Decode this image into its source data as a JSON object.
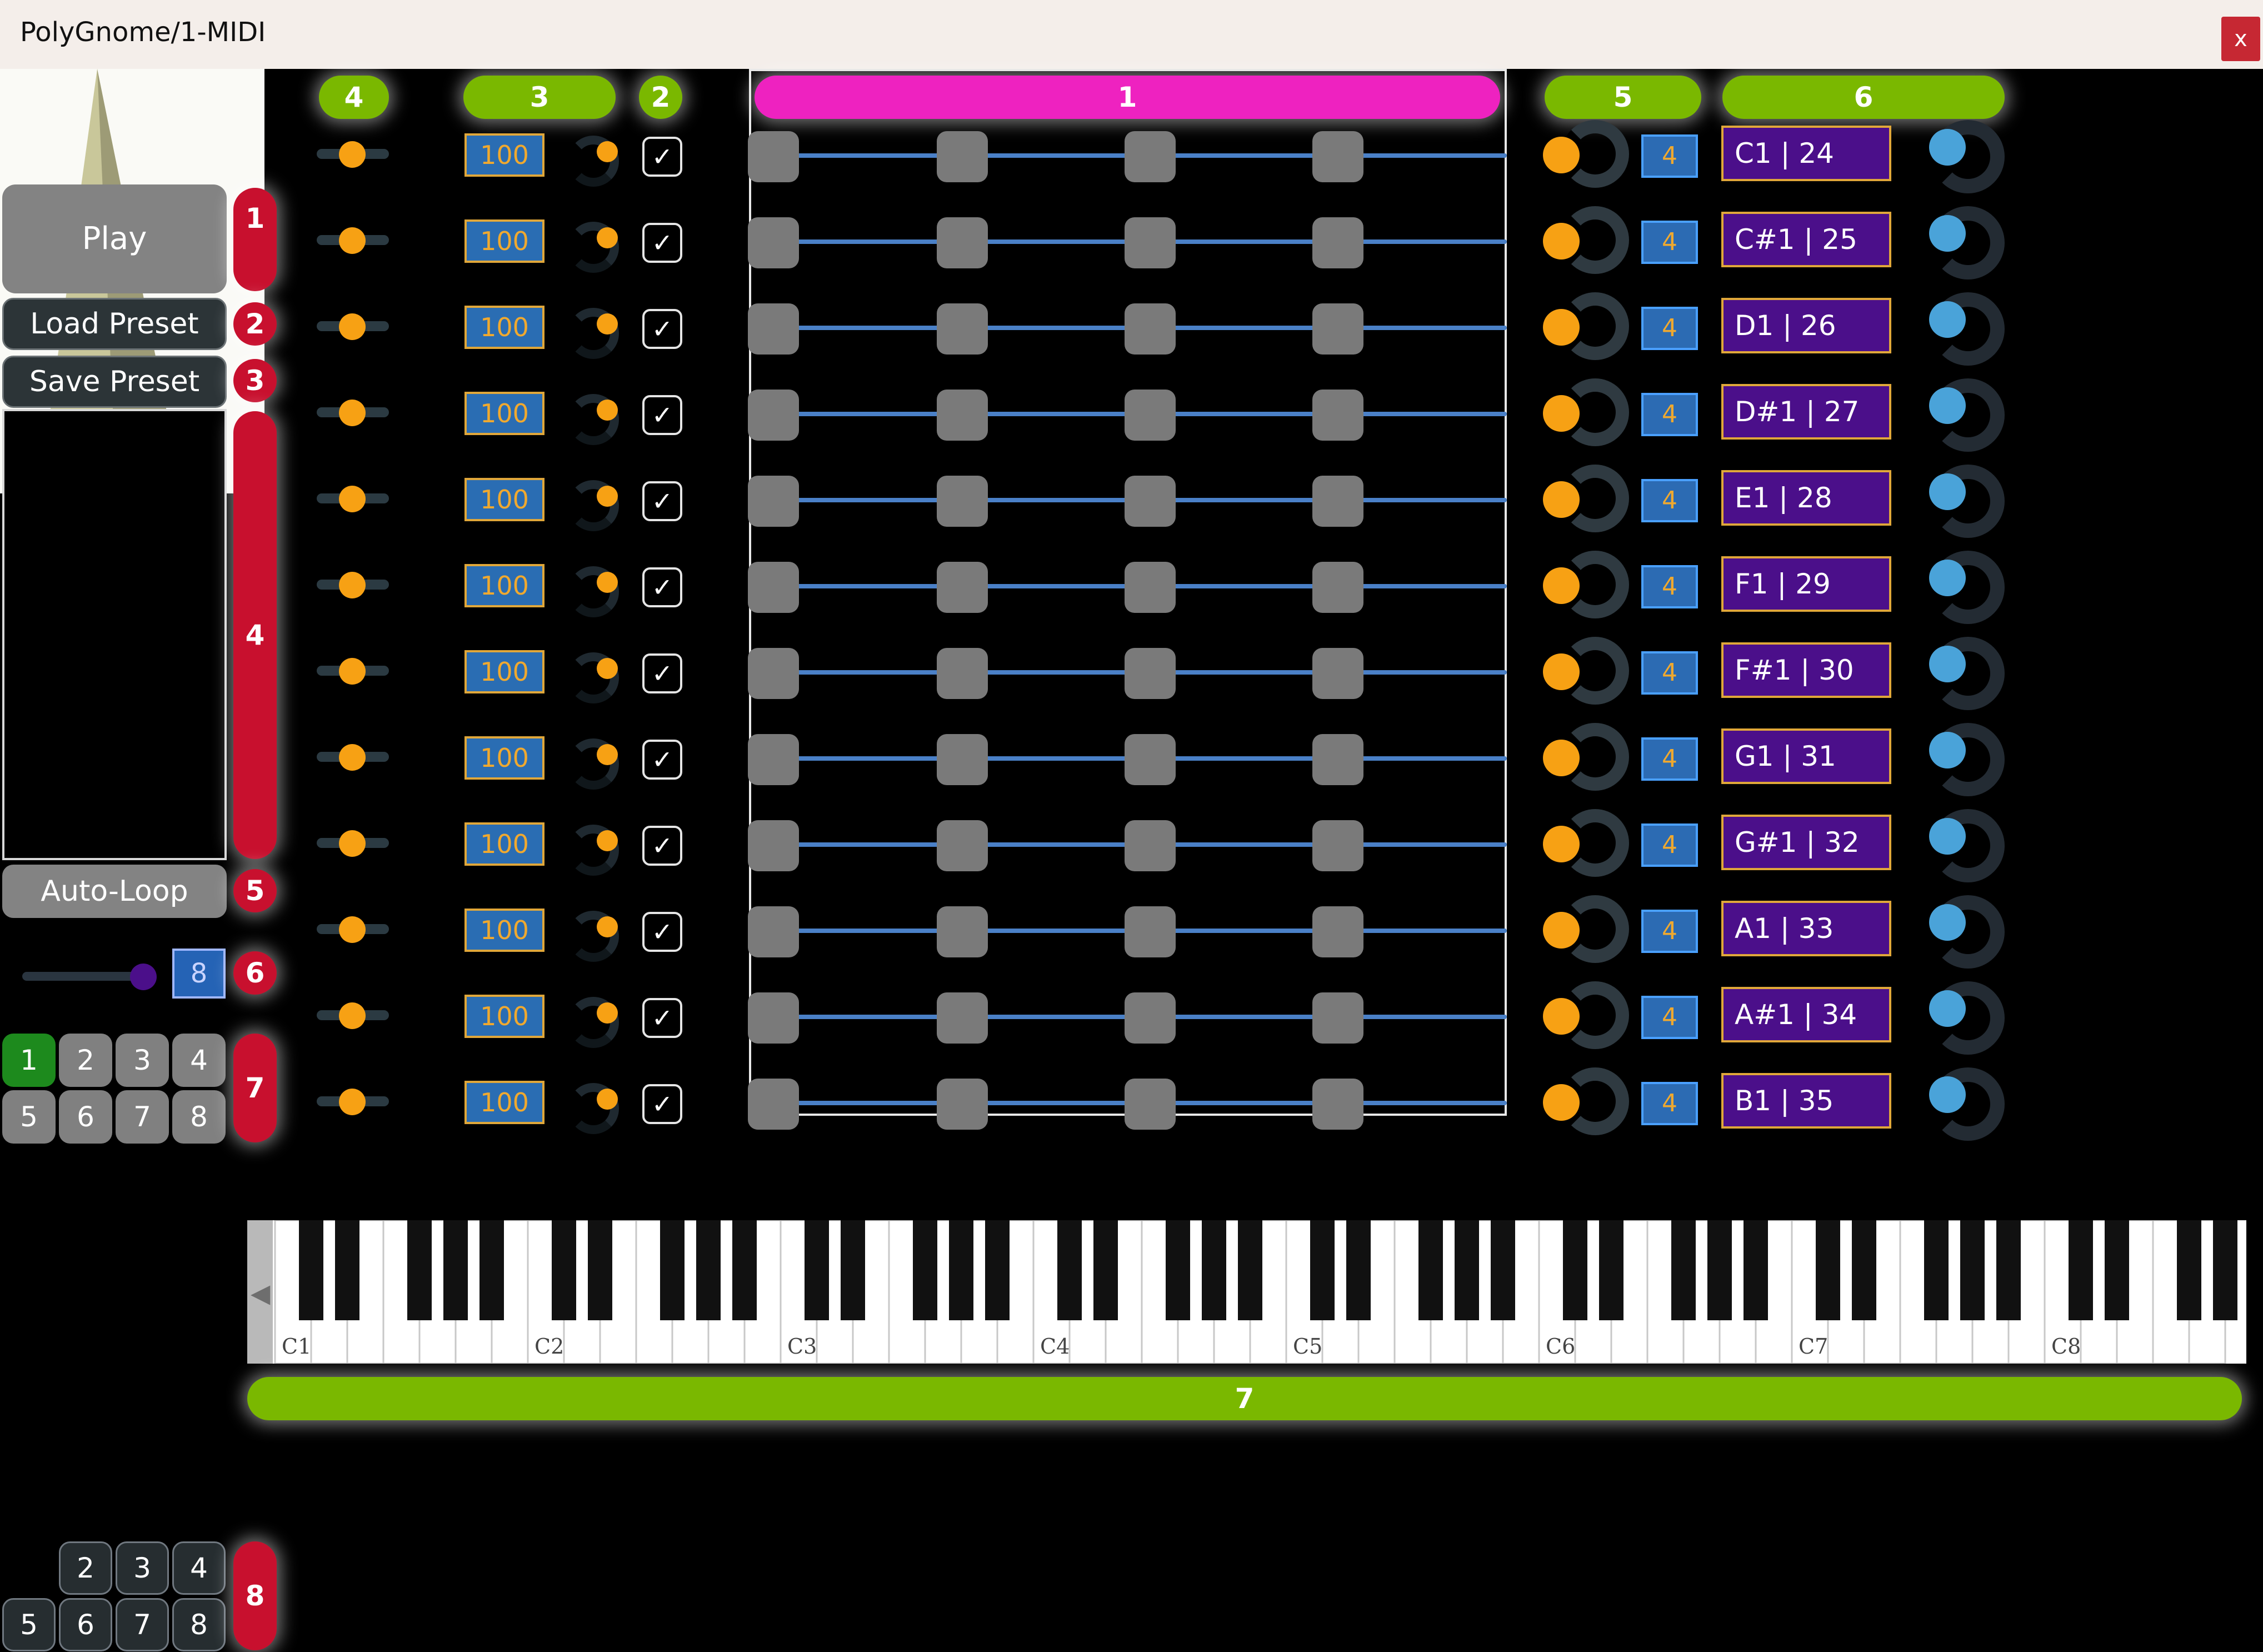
{
  "window": {
    "title": "PolyGnome/1-MIDI",
    "close": "x"
  },
  "left": {
    "play": "Play",
    "load": "Load Preset",
    "save": "Save Preset",
    "autoloop": "Auto-Loop",
    "steps_value": "8",
    "pattern_buttons": [
      "1",
      "2",
      "3",
      "4",
      "5",
      "6",
      "7",
      "8"
    ],
    "bottom_buttons_top": [
      "2",
      "3",
      "4"
    ],
    "bottom_buttons_bottom": [
      "5",
      "6",
      "7",
      "8"
    ]
  },
  "labels": {
    "red": [
      "1",
      "2",
      "3",
      "4",
      "5",
      "6",
      "7",
      "8"
    ],
    "green_headers": [
      "4",
      "3",
      "2",
      "5",
      "6"
    ],
    "pink_header": "1",
    "keyboard_label": "7"
  },
  "rows": [
    {
      "velocity": "100",
      "count": "4",
      "note": "C1 | 24"
    },
    {
      "velocity": "100",
      "count": "4",
      "note": "C#1 | 25"
    },
    {
      "velocity": "100",
      "count": "4",
      "note": "D1 | 26"
    },
    {
      "velocity": "100",
      "count": "4",
      "note": "D#1 | 27"
    },
    {
      "velocity": "100",
      "count": "4",
      "note": "E1 | 28"
    },
    {
      "velocity": "100",
      "count": "4",
      "note": "F1 | 29"
    },
    {
      "velocity": "100",
      "count": "4",
      "note": "F#1 | 30"
    },
    {
      "velocity": "100",
      "count": "4",
      "note": "G1 | 31"
    },
    {
      "velocity": "100",
      "count": "4",
      "note": "G#1 | 32"
    },
    {
      "velocity": "100",
      "count": "4",
      "note": "A1 | 33"
    },
    {
      "velocity": "100",
      "count": "4",
      "note": "A#1 | 34"
    },
    {
      "velocity": "100",
      "count": "4",
      "note": "B1 | 35"
    }
  ],
  "keyboard": {
    "octave_labels": [
      "C1",
      "C2",
      "C3",
      "C4",
      "C5",
      "C6",
      "C7",
      "C8"
    ],
    "left_arrow": "◀"
  },
  "checkmark": "✓",
  "colors": {
    "accent_green": "#7ab800",
    "accent_red": "#c8102e",
    "accent_pink": "#ee22c0",
    "orange": "#f7a114",
    "purple": "#4b0f8a",
    "blue": "#4aa3d9"
  }
}
